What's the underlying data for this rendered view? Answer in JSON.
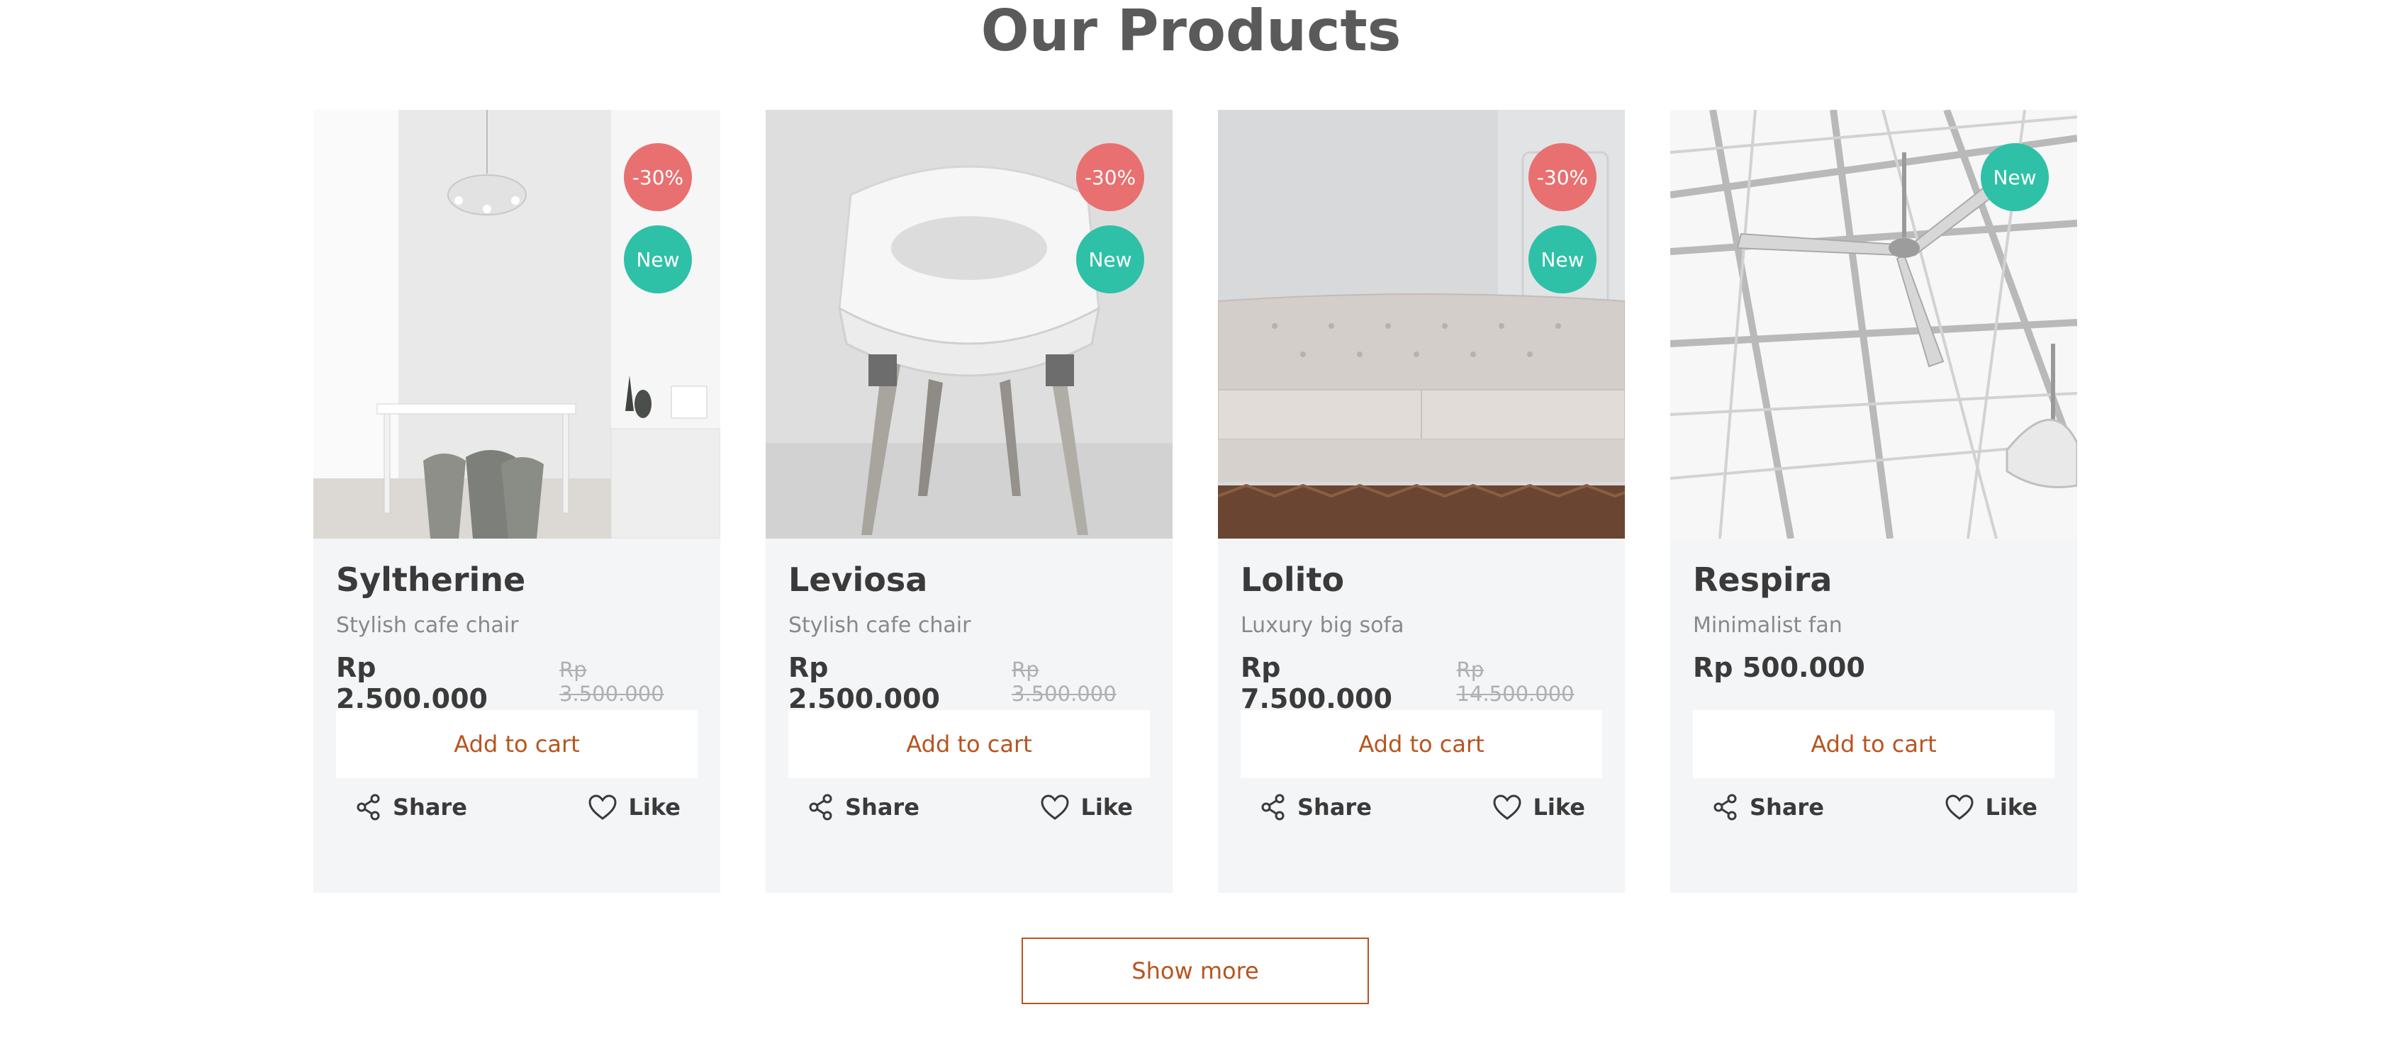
{
  "section": {
    "title": "Our Products"
  },
  "colors": {
    "discount_badge": "#e97070",
    "new_badge": "#2ec1a7",
    "accent": "#b8541f",
    "card_bg": "#f4f5f7"
  },
  "products": [
    {
      "name": "Syltherine",
      "subtitle": "Stylish cafe chair",
      "price": "Rp 2.500.000",
      "old_price": "Rp 3.500.000",
      "discount_badge": "-30%",
      "new_badge": "New",
      "add_to_cart": "Add to cart",
      "share": "Share",
      "like": "Like"
    },
    {
      "name": "Leviosa",
      "subtitle": "Stylish cafe chair",
      "price": "Rp 2.500.000",
      "old_price": "Rp 3.500.000",
      "discount_badge": "-30%",
      "new_badge": "New",
      "add_to_cart": "Add to cart",
      "share": "Share",
      "like": "Like"
    },
    {
      "name": "Lolito",
      "subtitle": "Luxury big sofa",
      "price": "Rp 7.500.000",
      "old_price": "Rp 14.500.000",
      "discount_badge": "-30%",
      "new_badge": "New",
      "add_to_cart": "Add to cart",
      "share": "Share",
      "like": "Like"
    },
    {
      "name": "Respira",
      "subtitle": "Minimalist fan",
      "price": "Rp 500.000",
      "new_badge": "New",
      "add_to_cart": "Add to cart",
      "share": "Share",
      "like": "Like"
    }
  ],
  "show_more": {
    "label": "Show more"
  }
}
